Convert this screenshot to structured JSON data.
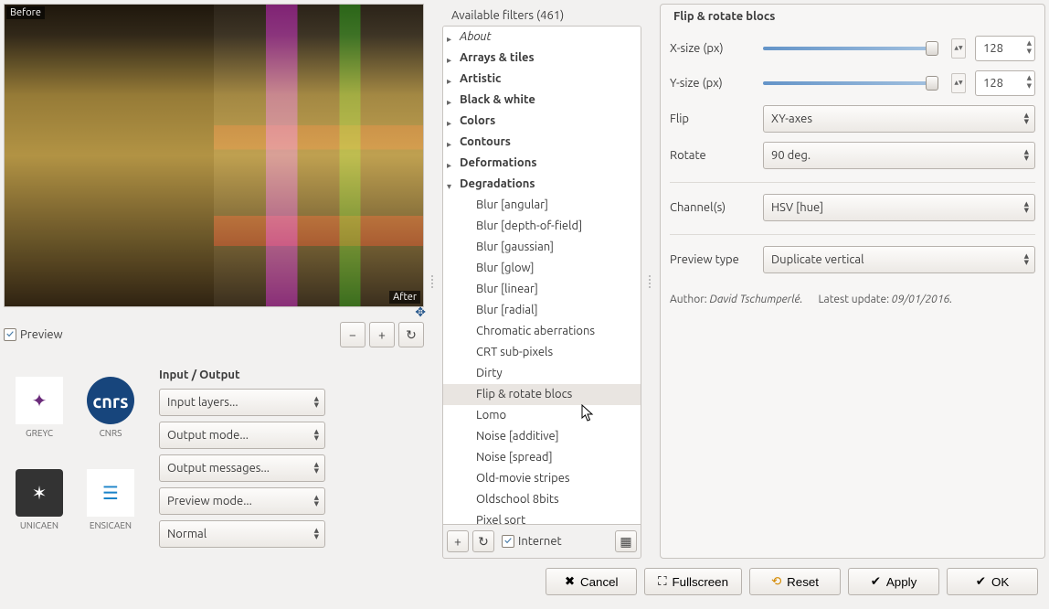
{
  "preview": {
    "before": "Before",
    "after": "After",
    "checkbox_label": "Preview"
  },
  "preview_buttons": {
    "zoom_out": "−",
    "zoom_in": "+",
    "reset": "↻"
  },
  "io": {
    "title": "Input / Output",
    "input_layers": "Input layers...",
    "output_mode": "Output mode...",
    "output_messages": "Output messages...",
    "preview_mode": "Preview mode...",
    "normal": "Normal"
  },
  "logos": {
    "greyc": "GREYC",
    "cnrs": "CNRS",
    "unicaen": "UNICAEN",
    "ensicaen": "ENSICAEN"
  },
  "filters": {
    "header": "Available filters (461)",
    "categories": {
      "about": "About",
      "arrays_tiles": "Arrays & tiles",
      "artistic": "Artistic",
      "black_white": "Black & white",
      "colors": "Colors",
      "contours": "Contours",
      "deformations": "Deformations",
      "degradations": "Degradations"
    },
    "degradations_items": [
      "Blur [angular]",
      "Blur [depth-of-field]",
      "Blur [gaussian]",
      "Blur [glow]",
      "Blur [linear]",
      "Blur [radial]",
      "Chromatic aberrations",
      "CRT sub-pixels",
      "Dirty",
      "Flip & rotate blocs",
      "Lomo",
      "Noise [additive]",
      "Noise [spread]",
      "Old-movie stripes",
      "Oldschool 8bits",
      "Pixel sort"
    ],
    "selected": "Flip & rotate blocs",
    "toolbar": {
      "internet": "Internet"
    }
  },
  "params": {
    "title": "Flip & rotate blocs",
    "xsize_label": "X-size (px)",
    "xsize_value": "128",
    "ysize_label": "Y-size (px)",
    "ysize_value": "128",
    "flip_label": "Flip",
    "flip_value": "XY-axes",
    "rotate_label": "Rotate",
    "rotate_value": "90 deg.",
    "channels_label": "Channel(s)",
    "channels_value": "HSV [hue]",
    "preview_type_label": "Preview type",
    "preview_type_value": "Duplicate vertical",
    "author_label": "Author: ",
    "author": "David Tschumperlé.",
    "update_label": "Latest update: ",
    "update": "09/01/2016."
  },
  "footer": {
    "cancel": "Cancel",
    "fullscreen": "Fullscreen",
    "reset": "Reset",
    "apply": "Apply",
    "ok": "OK"
  }
}
